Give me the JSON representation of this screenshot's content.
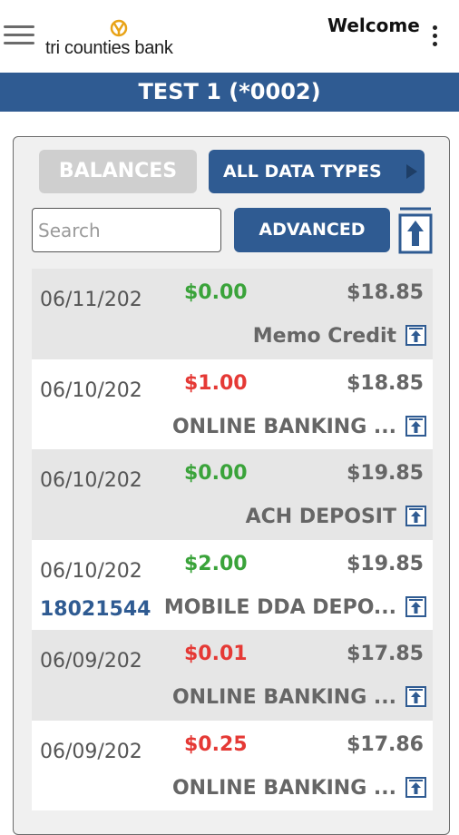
{
  "header": {
    "brand": "tri counties bank",
    "welcome": "Welcome"
  },
  "account": {
    "title": "TEST 1 (*0002)"
  },
  "controls": {
    "balances_label": "BALANCES",
    "data_types_label": "ALL DATA TYPES",
    "search_placeholder": "Search",
    "search_value": "",
    "advanced_label": "ADVANCED"
  },
  "transactions": [
    {
      "date": "06/11/202",
      "amount": "$0.00",
      "type": "credit",
      "balance": "$18.85",
      "description": "Memo Credit",
      "ref": ""
    },
    {
      "date": "06/10/202",
      "amount": "$1.00",
      "type": "debit",
      "balance": "$18.85",
      "description": "ONLINE BANKING ...",
      "ref": ""
    },
    {
      "date": "06/10/202",
      "amount": "$0.00",
      "type": "credit",
      "balance": "$19.85",
      "description": "ACH DEPOSIT",
      "ref": ""
    },
    {
      "date": "06/10/202",
      "amount": "$2.00",
      "type": "credit",
      "balance": "$19.85",
      "description": "MOBILE DDA DEPO...",
      "ref": "18021544"
    },
    {
      "date": "06/09/202",
      "amount": "$0.01",
      "type": "debit",
      "balance": "$17.85",
      "description": "ONLINE BANKING ...",
      "ref": ""
    },
    {
      "date": "06/09/202",
      "amount": "$0.25",
      "type": "debit",
      "balance": "$17.86",
      "description": "ONLINE BANKING ...",
      "ref": ""
    }
  ],
  "colors": {
    "brand_blue": "#2f5b92",
    "credit_green": "#3aa33a",
    "debit_red": "#e53935",
    "logo_gold": "#e8a317"
  },
  "icons": {
    "menu": "hamburger-menu-icon",
    "more": "more-vertical-icon",
    "scroll_top": "scroll-to-top-icon",
    "row_detail": "upload-arrow-icon"
  }
}
